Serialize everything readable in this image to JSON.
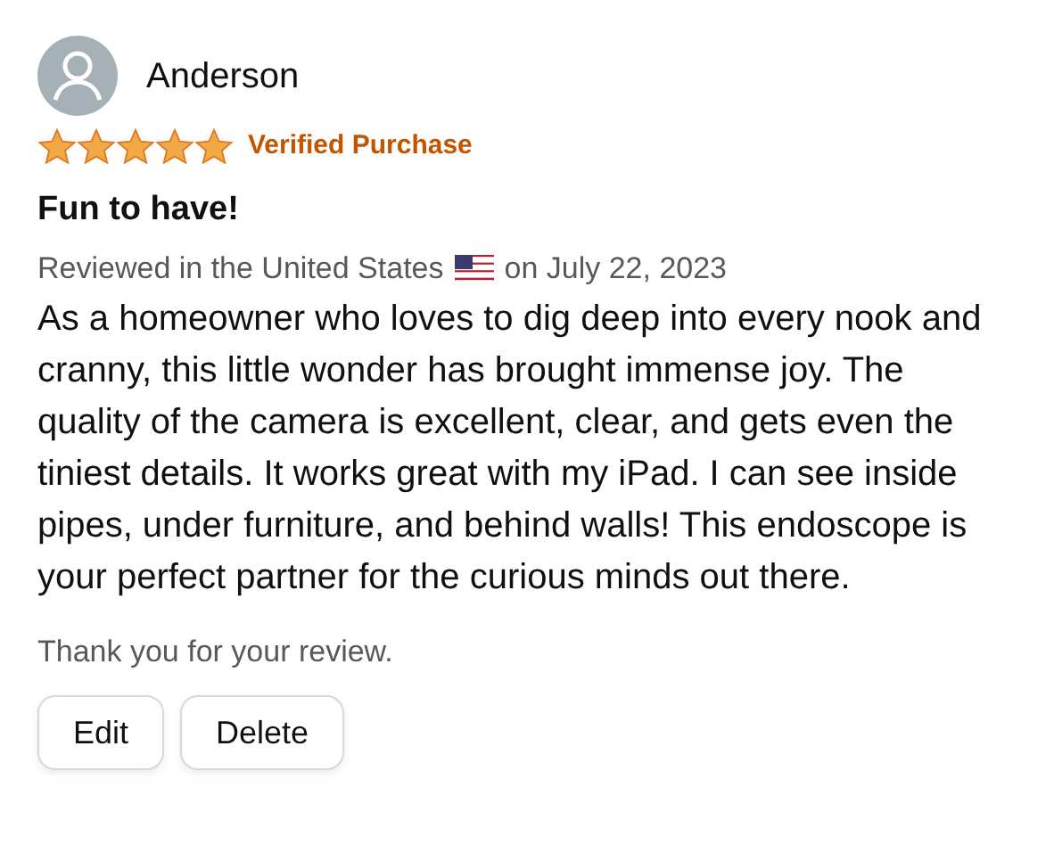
{
  "reviewer": {
    "name": "Anderson"
  },
  "review": {
    "stars": 5,
    "badge": "Verified Purchase",
    "title": "Fun to have!",
    "meta_prefix": "Reviewed in the United States",
    "meta_suffix": "on July 22, 2023",
    "body": "As a homeowner who loves to dig deep into every nook and cranny, this little wonder has brought immense joy. The quality of the camera is excellent, clear, and gets even the tiniest details. It works great with my iPad. I can see inside pipes, under furniture, and behind walls! This endoscope is your perfect partner for the curious minds out there."
  },
  "thanks": "Thank you for your review.",
  "buttons": [
    "Edit",
    "Delete"
  ]
}
